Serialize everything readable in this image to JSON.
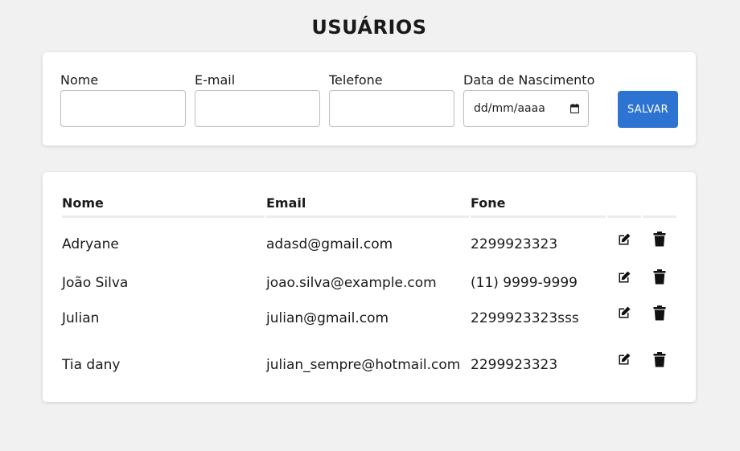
{
  "title": "USUÁRIOS",
  "form": {
    "fields": [
      {
        "label": "Nome",
        "value": "",
        "placeholder": ""
      },
      {
        "label": "E-mail",
        "value": "",
        "placeholder": ""
      },
      {
        "label": "Telefone",
        "value": "",
        "placeholder": ""
      },
      {
        "label": "Data de Nascimento",
        "placeholder": "dd/mm/aaaa"
      }
    ],
    "save_label": "SALVAR",
    "accent_color": "#2c73d2"
  },
  "table": {
    "columns": [
      "Nome",
      "Email",
      "Fone"
    ],
    "rows": [
      {
        "name": "Adryane",
        "email": "adasd@gmail.com",
        "phone": "2299923323"
      },
      {
        "name": "João Silva",
        "email": "joao.silva@example.com",
        "phone": "(11) 9999-9999"
      },
      {
        "name": "Julian",
        "email": "julian@gmail.com",
        "phone": "2299923323sss"
      },
      {
        "name": "Tia dany",
        "email": "julian_sempre@hotmail.com",
        "phone": "2299923323"
      }
    ],
    "row_actions": [
      "edit-icon",
      "trash-icon"
    ]
  }
}
